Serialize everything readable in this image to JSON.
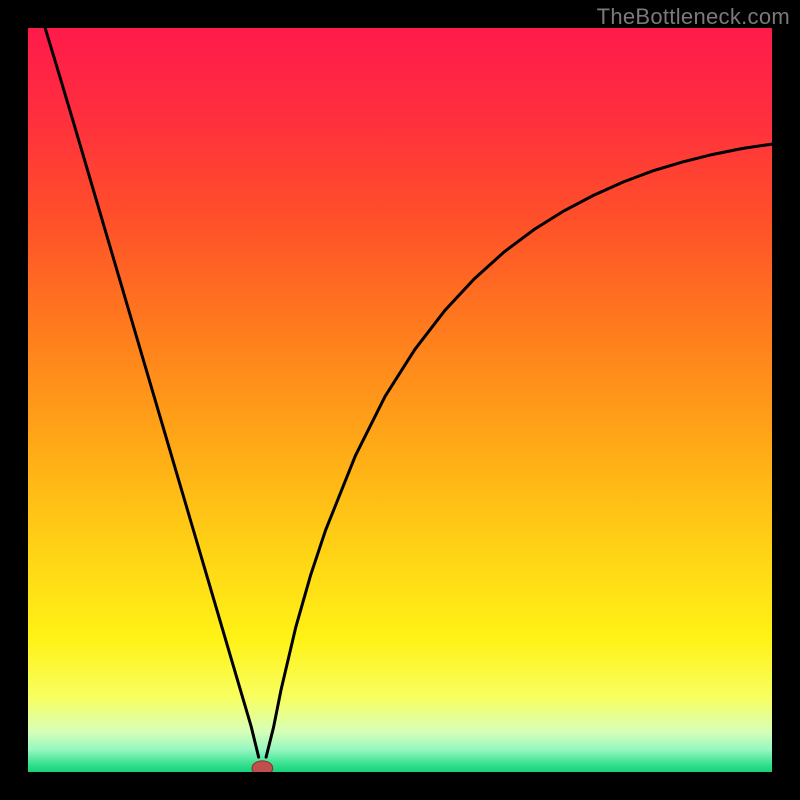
{
  "watermark": "TheBottleneck.com",
  "colors": {
    "bg": "#000000",
    "stroke": "#000000",
    "marker_fill": "#c0504d",
    "marker_stroke": "#8b2f2c"
  },
  "chart_data": {
    "type": "line",
    "title": "",
    "xlabel": "",
    "ylabel": "",
    "xlim": [
      0,
      100
    ],
    "ylim": [
      0,
      100
    ],
    "gradient_stops": [
      {
        "offset": 0.0,
        "color": "#ff1a4b"
      },
      {
        "offset": 0.12,
        "color": "#ff2f3e"
      },
      {
        "offset": 0.25,
        "color": "#ff4e2a"
      },
      {
        "offset": 0.4,
        "color": "#ff7a1e"
      },
      {
        "offset": 0.55,
        "color": "#ffa617"
      },
      {
        "offset": 0.7,
        "color": "#ffd215"
      },
      {
        "offset": 0.82,
        "color": "#fff215"
      },
      {
        "offset": 0.9,
        "color": "#f8ff60"
      },
      {
        "offset": 0.945,
        "color": "#d8ffb8"
      },
      {
        "offset": 0.97,
        "color": "#96f7c0"
      },
      {
        "offset": 0.99,
        "color": "#33e08e"
      },
      {
        "offset": 1.0,
        "color": "#15d27a"
      }
    ],
    "series": [
      {
        "name": "left-branch",
        "x": [
          2,
          4,
          6,
          8,
          10,
          12,
          14,
          16,
          18,
          20,
          22,
          24,
          26,
          28,
          29,
          30,
          31
        ],
        "values": [
          101,
          94.4,
          87.7,
          80.9,
          74.1,
          67.3,
          60.5,
          53.7,
          46.9,
          40.1,
          33.3,
          26.5,
          19.7,
          12.9,
          9.5,
          6.1,
          2.0
        ]
      },
      {
        "name": "right-branch",
        "x": [
          32,
          33,
          34,
          36,
          38,
          40,
          44,
          48,
          52,
          56,
          60,
          64,
          68,
          72,
          76,
          80,
          84,
          88,
          92,
          96,
          100
        ],
        "values": [
          2.0,
          6.0,
          11.0,
          19.5,
          26.5,
          32.5,
          42.5,
          50.5,
          56.8,
          62.0,
          66.3,
          69.9,
          72.9,
          75.4,
          77.5,
          79.3,
          80.8,
          82.0,
          83.0,
          83.8,
          84.4
        ]
      }
    ],
    "marker": {
      "x": 31.5,
      "y": 0.5,
      "rx": 1.4,
      "ry": 1.0
    }
  }
}
